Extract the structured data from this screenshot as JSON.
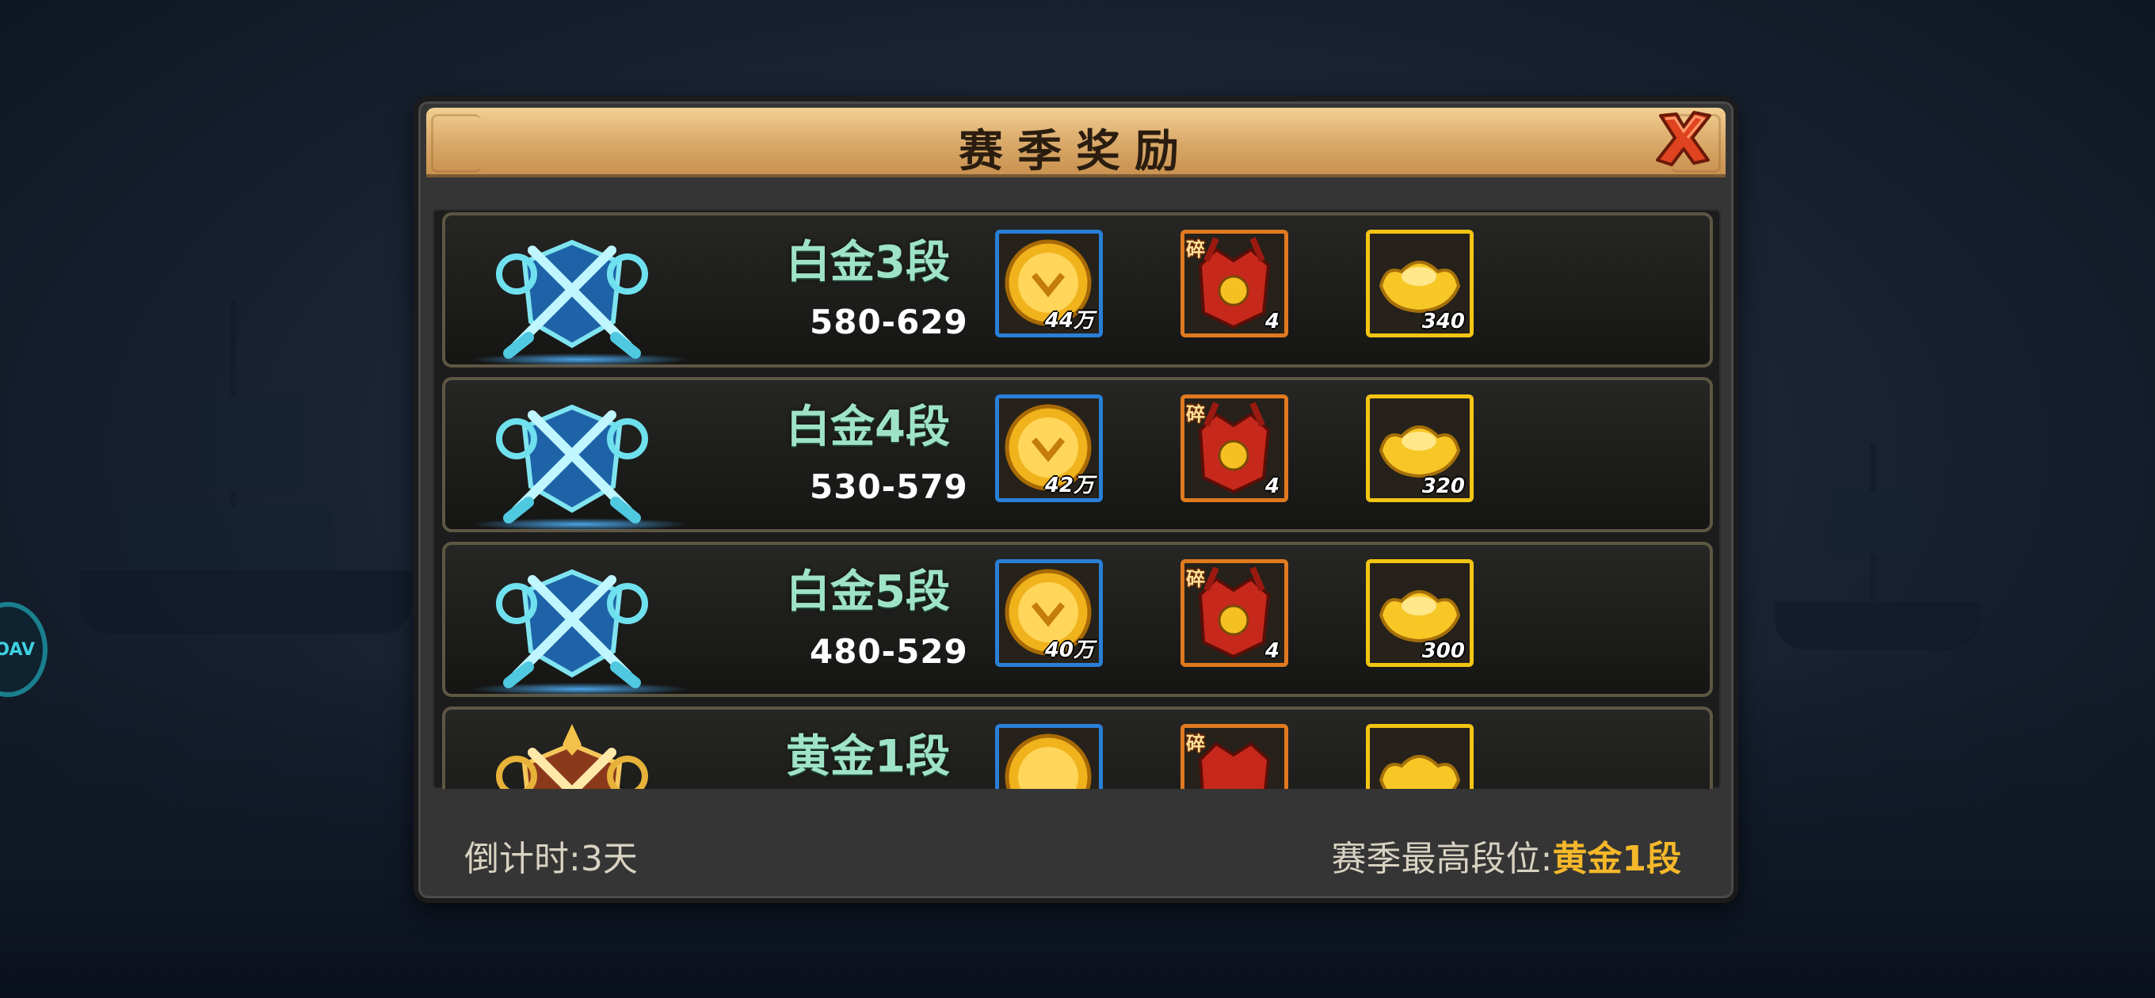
{
  "dialog": {
    "title": "赛季奖励",
    "close_icon": "close-x-icon"
  },
  "rewards": [
    {
      "tier": "白金3段",
      "score": "580-629",
      "icon": "platinum-crossed-swords-emblem-icon",
      "coin_qty": "44万",
      "frag_qty": "4",
      "ingot_qty": "340"
    },
    {
      "tier": "白金4段",
      "score": "530-579",
      "icon": "platinum-crossed-swords-emblem-icon",
      "coin_qty": "42万",
      "frag_qty": "4",
      "ingot_qty": "320"
    },
    {
      "tier": "白金5段",
      "score": "480-529",
      "icon": "platinum-crossed-swords-emblem-icon",
      "coin_qty": "40万",
      "frag_qty": "4",
      "ingot_qty": "300"
    },
    {
      "tier": "黄金1段",
      "score": "",
      "icon": "gold-crossed-swords-emblem-icon",
      "coin_qty": "",
      "frag_qty": "",
      "ingot_qty": ""
    }
  ],
  "fragment_tag": "碎",
  "footer": {
    "countdown_label": "倒计时:",
    "countdown_value": "3天",
    "best_rank_label": "赛季最高段位:",
    "best_rank_value": "黄金1段"
  },
  "side_badge": "VOAV",
  "colors": {
    "title_bar": "#d9a868",
    "tier_text": "#9fe3c7",
    "highlight": "#f5b82a",
    "coin_border": "#2a7fd6",
    "fragment_border": "#e07a20",
    "ingot_border": "#f2c515"
  }
}
